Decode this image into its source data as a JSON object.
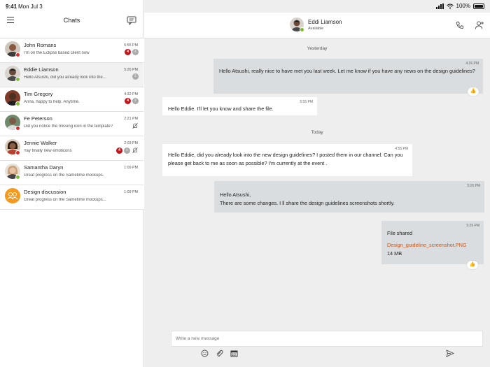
{
  "status_bar": {
    "time": "9:41",
    "date": "Mon Jul 3",
    "battery": "100%"
  },
  "sidebar": {
    "title": "Chats",
    "chats": [
      {
        "name": "John Romans",
        "preview": "I'm on the Eclipse based client now",
        "time": "5:55 PM",
        "unread": "4",
        "presence": "red",
        "avatar_color": "#8a5a40",
        "active": false
      },
      {
        "name": "Eddie Liamson",
        "preview": "Hello Atsushi, did you already look into the...",
        "time": "5:26 PM",
        "unread": "",
        "presence": "green",
        "avatar_color": "#6b4a38",
        "active": true
      },
      {
        "name": "Tim Gregory",
        "preview": "Anna, happy to help. Anytime.",
        "time": "4:32 PM",
        "unread": "4",
        "presence": "green",
        "avatar_color": "#4a3020",
        "active": false
      },
      {
        "name": "Fe Peterson",
        "preview": "Did you notice the missing icon in the template?",
        "time": "2:21 PM",
        "unread": "",
        "presence": "red",
        "avatar_color": "#7b5a48",
        "active": false
      },
      {
        "name": "Jennie Walker",
        "preview": "Yay finally new emoticons",
        "time": "2:03 PM",
        "unread": "4",
        "presence": "red",
        "avatar_color": "#5a3a28",
        "active": false
      },
      {
        "name": "Samantha Daryn",
        "preview": "Great progress on the Sametime mockups.",
        "time": "1:09 PM",
        "unread": "",
        "presence": "green",
        "avatar_color": "#c9a27a",
        "active": false
      },
      {
        "name": "Design discussion",
        "preview": "Great progress on the Sametime mockups...",
        "time": "1:09 PM",
        "unread": "",
        "presence": "",
        "avatar_color": "#f39a1e",
        "active": false
      }
    ]
  },
  "conversation": {
    "contact_name": "Eddi Liamson",
    "contact_status": "Available",
    "day_yesterday": "Yesterday",
    "day_today": "Today",
    "messages": [
      {
        "direction": "out",
        "time": "4:26 PM",
        "text": "Hello Atsushi, really nice to have met you last week. Let me know if you have any news on the design guidelines?"
      },
      {
        "direction": "in",
        "time": "5:55 PM",
        "text": "Hello Eddie. I'll let you know and share the file."
      },
      {
        "direction": "in",
        "time": "4:55 PM",
        "text": "Hello Eddie, did you already look into the new design guidelines? I posted them in our channel. Can you please get back to me as soon as possible? I'm currently at the event ."
      },
      {
        "direction": "out",
        "time": "5:26 PM",
        "line1": "Hello Atsushi,",
        "line2": "There are some changes. I ll share the design guidelines screenshots shortly."
      },
      {
        "direction": "out",
        "time": "5:26 PM",
        "title": "File shared",
        "file_name": "Design_guideline_screenshot.PNG",
        "file_size": "14 MB"
      }
    ],
    "composer_placeholder": "Write a new message"
  },
  "colors": {
    "accent_link": "#c3571e",
    "unread_badge": "#c0161b",
    "presence_available": "#7bbd30",
    "presence_busy": "#d92b2b"
  },
  "icons": [
    "menu-icon",
    "compose-icon",
    "call-icon",
    "add-person-icon",
    "emoji-icon",
    "attachment-icon",
    "calendar-icon",
    "send-icon",
    "thumbs-up-icon",
    "muted-bell-icon",
    "pin-icon"
  ]
}
